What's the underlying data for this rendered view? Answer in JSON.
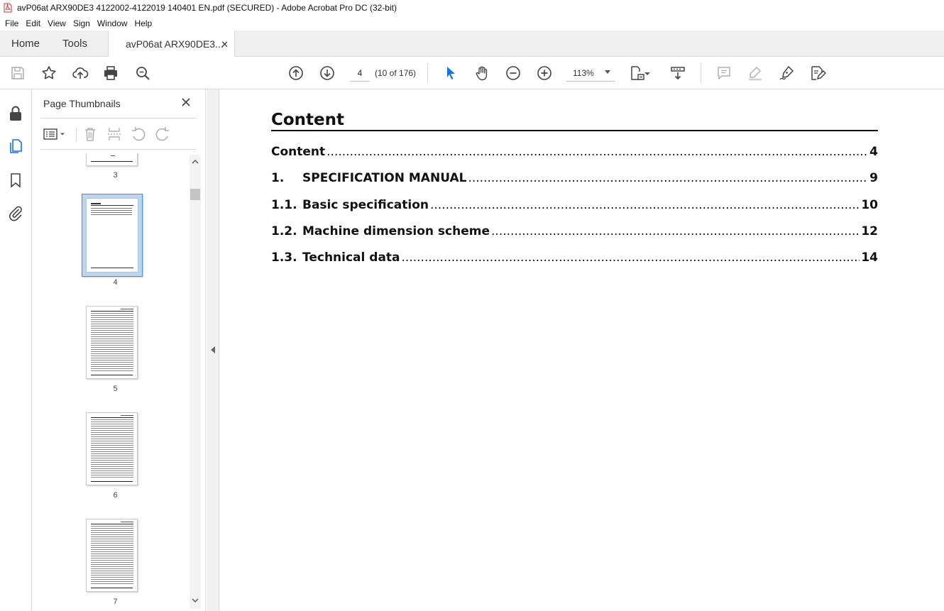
{
  "window": {
    "title": "avP06at ARX90DE3 4122002-4122019 140401 EN.pdf (SECURED) - Adobe Acrobat Pro DC (32-bit)"
  },
  "menu": {
    "items": [
      "File",
      "Edit",
      "View",
      "Sign",
      "Window",
      "Help"
    ]
  },
  "tabs": {
    "home": "Home",
    "tools": "Tools",
    "document": "avP06at ARX90DE3..."
  },
  "toolbar": {
    "page_number": "4",
    "page_count": "(10 of 176)",
    "zoom": "113%"
  },
  "thumbnails_panel": {
    "title": "Page Thumbnails",
    "pages": [
      "3",
      "4",
      "5",
      "6",
      "7"
    ],
    "selected_page": "4"
  },
  "document": {
    "heading": "Content",
    "toc": [
      {
        "num": "",
        "title": "Content",
        "page": "4"
      },
      {
        "num": "1.",
        "title": "SPECIFICATION MANUAL",
        "page": "9"
      },
      {
        "num": "1.1.",
        "title": "Basic specification",
        "page": "10"
      },
      {
        "num": "1.2.",
        "title": "Machine dimension scheme",
        "page": "12"
      },
      {
        "num": "1.3.",
        "title": "Technical data",
        "page": "14"
      }
    ]
  },
  "colors": {
    "accent": "#4a90d9",
    "pdf_red": "#d32f2f",
    "cursor_blue": "#1473e6"
  }
}
